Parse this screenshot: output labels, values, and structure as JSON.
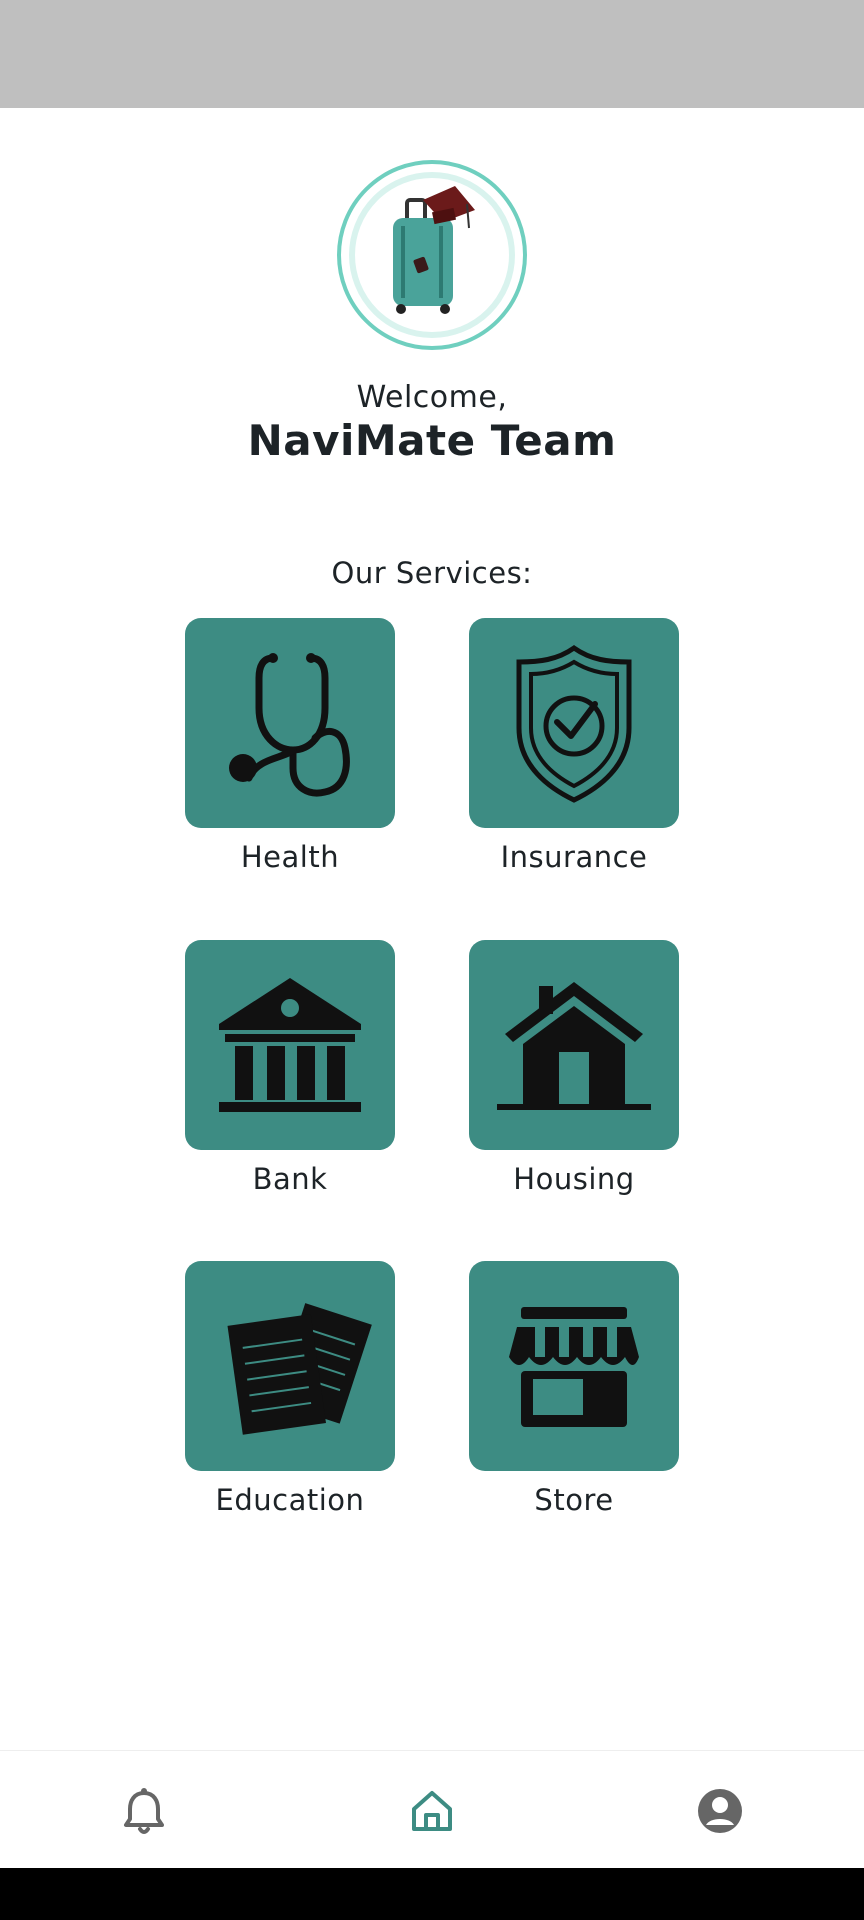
{
  "header": {
    "welcome_text": "Welcome,",
    "user_name": "NaviMate Team"
  },
  "services": {
    "heading": "Our Services:",
    "items": [
      {
        "label": "Health",
        "icon": "stethoscope-icon"
      },
      {
        "label": "Insurance",
        "icon": "shield-check-icon"
      },
      {
        "label": "Bank",
        "icon": "bank-icon"
      },
      {
        "label": "Housing",
        "icon": "house-icon"
      },
      {
        "label": "Education",
        "icon": "documents-icon"
      },
      {
        "label": "Store",
        "icon": "storefront-icon"
      }
    ]
  },
  "bottom_nav": {
    "items": [
      {
        "name": "notifications",
        "icon": "bell-icon",
        "active": false
      },
      {
        "name": "home",
        "icon": "home-icon",
        "active": true
      },
      {
        "name": "profile",
        "icon": "profile-icon",
        "active": false
      }
    ]
  },
  "colors": {
    "tile_background": "#3d8c83",
    "accent": "#3d8c83",
    "avatar_ring": "#6fcfbf",
    "status_bar": "#bfbfbf",
    "nav_inactive": "#666666"
  }
}
